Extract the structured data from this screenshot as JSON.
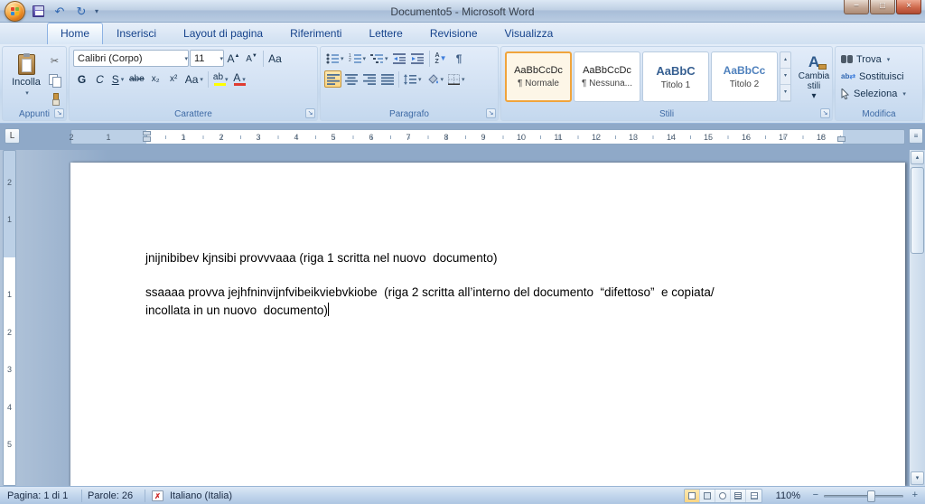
{
  "window": {
    "title": "Documento5 - Microsoft Word"
  },
  "icons": {
    "dropdown": "▾",
    "up_arrow": "▲",
    "down_arrow": "▼",
    "small_up": "▴",
    "small_down": "▾",
    "more": "▾≡",
    "undo": "↶",
    "redo": "↻",
    "scissors": "✂",
    "pilcrow": "¶",
    "dialog_launcher": "↘",
    "minimize": "−",
    "maximize": "□",
    "close": "×",
    "tab_selector": "L",
    "ruler_toggle": "≡",
    "minus": "−",
    "plus": "+",
    "spell_x": "✗",
    "replace_arrows": "⇄"
  },
  "tabs": [
    "Home",
    "Inserisci",
    "Layout di pagina",
    "Riferimenti",
    "Lettere",
    "Revisione",
    "Visualizza"
  ],
  "ribbon": {
    "clipboard": {
      "group": "Appunti",
      "paste": "Incolla"
    },
    "font": {
      "group": "Carattere",
      "name": "Calibri (Corpo)",
      "size": "11",
      "grow": "A",
      "shrink": "A",
      "clear": "Aa",
      "bold": "G",
      "italic": "C",
      "underline": "S",
      "strike": "abe",
      "subscript": "x₂",
      "superscript": "x²",
      "case": "Aa",
      "highlight": "ab",
      "color": "A"
    },
    "paragraph": {
      "group": "Paragrafo",
      "sort_top": "A",
      "sort_bottom": "Z"
    },
    "styles": {
      "group": "Stili",
      "items": [
        {
          "preview": "AaBbCcDc",
          "name": "¶ Normale"
        },
        {
          "preview": "AaBbCcDc",
          "name": "¶ Nessuna..."
        },
        {
          "preview": "AaBbC",
          "name": "Titolo 1"
        },
        {
          "preview": "AaBbCc",
          "name": "Titolo 2"
        }
      ],
      "change": "Cambia stili"
    },
    "editing": {
      "group": "Modifica",
      "find": "Trova",
      "replace": "Sostituisci",
      "select": "Seleziona",
      "replace_letters": "ab"
    }
  },
  "ruler": {
    "h_margin": [
      "2",
      "1"
    ],
    "h_numbers": [
      "1",
      "2",
      "3",
      "4",
      "5",
      "6",
      "7",
      "8",
      "9",
      "10",
      "11",
      "12",
      "13",
      "14",
      "15",
      "16",
      "17",
      "18"
    ],
    "v_margin": [
      "2",
      "1"
    ],
    "v_numbers": [
      "1",
      "2",
      "3",
      "4",
      "5"
    ]
  },
  "document": {
    "paragraphs": [
      {
        "lines": [
          "jnijnibibev kjnsibi provvvaaa (riga 1 scritta nel nuovo  documento)"
        ]
      },
      {
        "lines": [
          "ssaaaa provva jejhfninvijnfvibeikviebvkiobe  (riga 2 scritta all’interno del documento  “difettoso”  e copiata/",
          "incollata in un nuovo  documento)"
        ]
      }
    ]
  },
  "status": {
    "page": "Pagina: 1 di 1",
    "words": "Parole: 26",
    "language": "Italiano (Italia)",
    "zoom": "110%"
  }
}
